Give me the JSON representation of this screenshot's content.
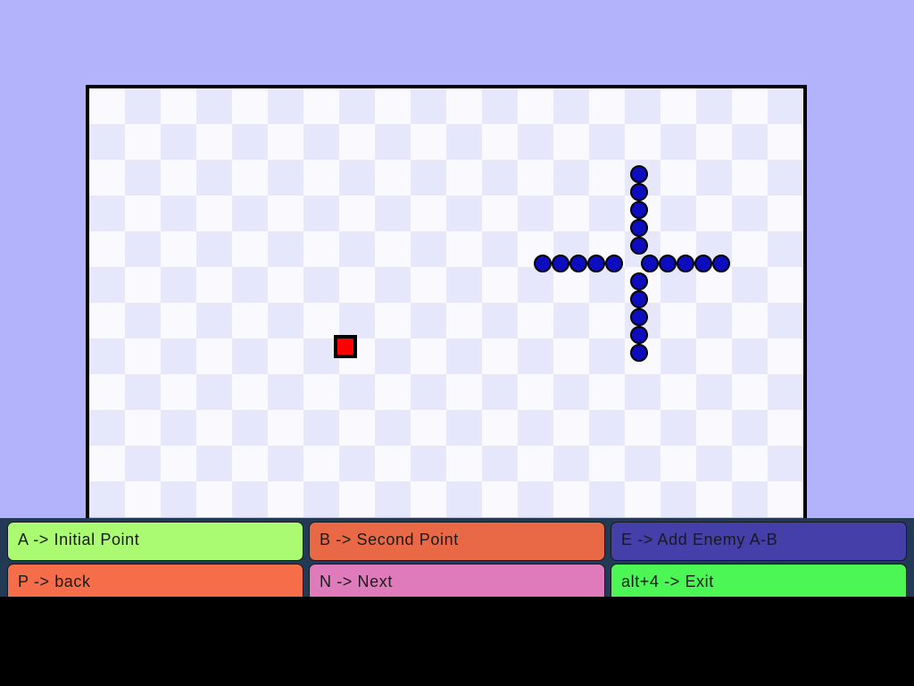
{
  "colors": {
    "backdrop": "#b3b3fb",
    "cell_light": "#fafafe",
    "cell_dark": "#e7e7fb",
    "enemy": "#0d0dbf",
    "player": "#ff0000",
    "panel": "#223a55"
  },
  "grid": {
    "columns": 20,
    "rows": 12
  },
  "player": {
    "col": 7.4,
    "row": 7.4
  },
  "enemies": {
    "vertical_top": {
      "col": 15.15,
      "rows": [
        2.15,
        2.65,
        3.15,
        3.65,
        4.15
      ]
    },
    "horizontal_left": {
      "row": 4.65,
      "cols": [
        12.45,
        12.95,
        13.45,
        13.95,
        14.45
      ]
    },
    "horizontal_right": {
      "row": 4.65,
      "cols": [
        15.45,
        15.95,
        16.45,
        16.95,
        17.45
      ]
    },
    "vertical_bottom": {
      "col": 15.15,
      "rows": [
        5.15,
        5.65,
        6.15,
        6.65,
        7.15
      ]
    }
  },
  "controls": [
    {
      "id": "a",
      "label": "A -> Initial Point",
      "color": "#aafa72"
    },
    {
      "id": "b",
      "label": "B -> Second Point",
      "color": "#e96946"
    },
    {
      "id": "e",
      "label": "E -> Add Enemy A-B",
      "color": "#443fa9"
    },
    {
      "id": "p",
      "label": "P -> back",
      "color": "#f56d49"
    },
    {
      "id": "n",
      "label": "N -> Next",
      "color": "#e07bbb"
    },
    {
      "id": "exit",
      "label": "alt+4 -> Exit",
      "color": "#4bf655"
    }
  ]
}
